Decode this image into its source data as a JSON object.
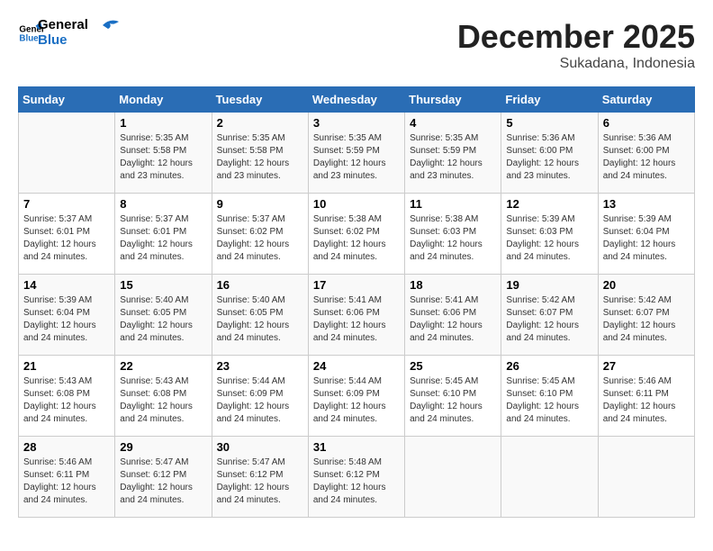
{
  "header": {
    "logo_line1": "General",
    "logo_line2": "Blue",
    "month": "December 2025",
    "location": "Sukadana, Indonesia"
  },
  "weekdays": [
    "Sunday",
    "Monday",
    "Tuesday",
    "Wednesday",
    "Thursday",
    "Friday",
    "Saturday"
  ],
  "weeks": [
    [
      {
        "day": "",
        "info": ""
      },
      {
        "day": "1",
        "info": "Sunrise: 5:35 AM\nSunset: 5:58 PM\nDaylight: 12 hours\nand 23 minutes."
      },
      {
        "day": "2",
        "info": "Sunrise: 5:35 AM\nSunset: 5:58 PM\nDaylight: 12 hours\nand 23 minutes."
      },
      {
        "day": "3",
        "info": "Sunrise: 5:35 AM\nSunset: 5:59 PM\nDaylight: 12 hours\nand 23 minutes."
      },
      {
        "day": "4",
        "info": "Sunrise: 5:35 AM\nSunset: 5:59 PM\nDaylight: 12 hours\nand 23 minutes."
      },
      {
        "day": "5",
        "info": "Sunrise: 5:36 AM\nSunset: 6:00 PM\nDaylight: 12 hours\nand 23 minutes."
      },
      {
        "day": "6",
        "info": "Sunrise: 5:36 AM\nSunset: 6:00 PM\nDaylight: 12 hours\nand 24 minutes."
      }
    ],
    [
      {
        "day": "7",
        "info": "Sunrise: 5:37 AM\nSunset: 6:01 PM\nDaylight: 12 hours\nand 24 minutes."
      },
      {
        "day": "8",
        "info": "Sunrise: 5:37 AM\nSunset: 6:01 PM\nDaylight: 12 hours\nand 24 minutes."
      },
      {
        "day": "9",
        "info": "Sunrise: 5:37 AM\nSunset: 6:02 PM\nDaylight: 12 hours\nand 24 minutes."
      },
      {
        "day": "10",
        "info": "Sunrise: 5:38 AM\nSunset: 6:02 PM\nDaylight: 12 hours\nand 24 minutes."
      },
      {
        "day": "11",
        "info": "Sunrise: 5:38 AM\nSunset: 6:03 PM\nDaylight: 12 hours\nand 24 minutes."
      },
      {
        "day": "12",
        "info": "Sunrise: 5:39 AM\nSunset: 6:03 PM\nDaylight: 12 hours\nand 24 minutes."
      },
      {
        "day": "13",
        "info": "Sunrise: 5:39 AM\nSunset: 6:04 PM\nDaylight: 12 hours\nand 24 minutes."
      }
    ],
    [
      {
        "day": "14",
        "info": "Sunrise: 5:39 AM\nSunset: 6:04 PM\nDaylight: 12 hours\nand 24 minutes."
      },
      {
        "day": "15",
        "info": "Sunrise: 5:40 AM\nSunset: 6:05 PM\nDaylight: 12 hours\nand 24 minutes."
      },
      {
        "day": "16",
        "info": "Sunrise: 5:40 AM\nSunset: 6:05 PM\nDaylight: 12 hours\nand 24 minutes."
      },
      {
        "day": "17",
        "info": "Sunrise: 5:41 AM\nSunset: 6:06 PM\nDaylight: 12 hours\nand 24 minutes."
      },
      {
        "day": "18",
        "info": "Sunrise: 5:41 AM\nSunset: 6:06 PM\nDaylight: 12 hours\nand 24 minutes."
      },
      {
        "day": "19",
        "info": "Sunrise: 5:42 AM\nSunset: 6:07 PM\nDaylight: 12 hours\nand 24 minutes."
      },
      {
        "day": "20",
        "info": "Sunrise: 5:42 AM\nSunset: 6:07 PM\nDaylight: 12 hours\nand 24 minutes."
      }
    ],
    [
      {
        "day": "21",
        "info": "Sunrise: 5:43 AM\nSunset: 6:08 PM\nDaylight: 12 hours\nand 24 minutes."
      },
      {
        "day": "22",
        "info": "Sunrise: 5:43 AM\nSunset: 6:08 PM\nDaylight: 12 hours\nand 24 minutes."
      },
      {
        "day": "23",
        "info": "Sunrise: 5:44 AM\nSunset: 6:09 PM\nDaylight: 12 hours\nand 24 minutes."
      },
      {
        "day": "24",
        "info": "Sunrise: 5:44 AM\nSunset: 6:09 PM\nDaylight: 12 hours\nand 24 minutes."
      },
      {
        "day": "25",
        "info": "Sunrise: 5:45 AM\nSunset: 6:10 PM\nDaylight: 12 hours\nand 24 minutes."
      },
      {
        "day": "26",
        "info": "Sunrise: 5:45 AM\nSunset: 6:10 PM\nDaylight: 12 hours\nand 24 minutes."
      },
      {
        "day": "27",
        "info": "Sunrise: 5:46 AM\nSunset: 6:11 PM\nDaylight: 12 hours\nand 24 minutes."
      }
    ],
    [
      {
        "day": "28",
        "info": "Sunrise: 5:46 AM\nSunset: 6:11 PM\nDaylight: 12 hours\nand 24 minutes."
      },
      {
        "day": "29",
        "info": "Sunrise: 5:47 AM\nSunset: 6:12 PM\nDaylight: 12 hours\nand 24 minutes."
      },
      {
        "day": "30",
        "info": "Sunrise: 5:47 AM\nSunset: 6:12 PM\nDaylight: 12 hours\nand 24 minutes."
      },
      {
        "day": "31",
        "info": "Sunrise: 5:48 AM\nSunset: 6:12 PM\nDaylight: 12 hours\nand 24 minutes."
      },
      {
        "day": "",
        "info": ""
      },
      {
        "day": "",
        "info": ""
      },
      {
        "day": "",
        "info": ""
      }
    ]
  ]
}
